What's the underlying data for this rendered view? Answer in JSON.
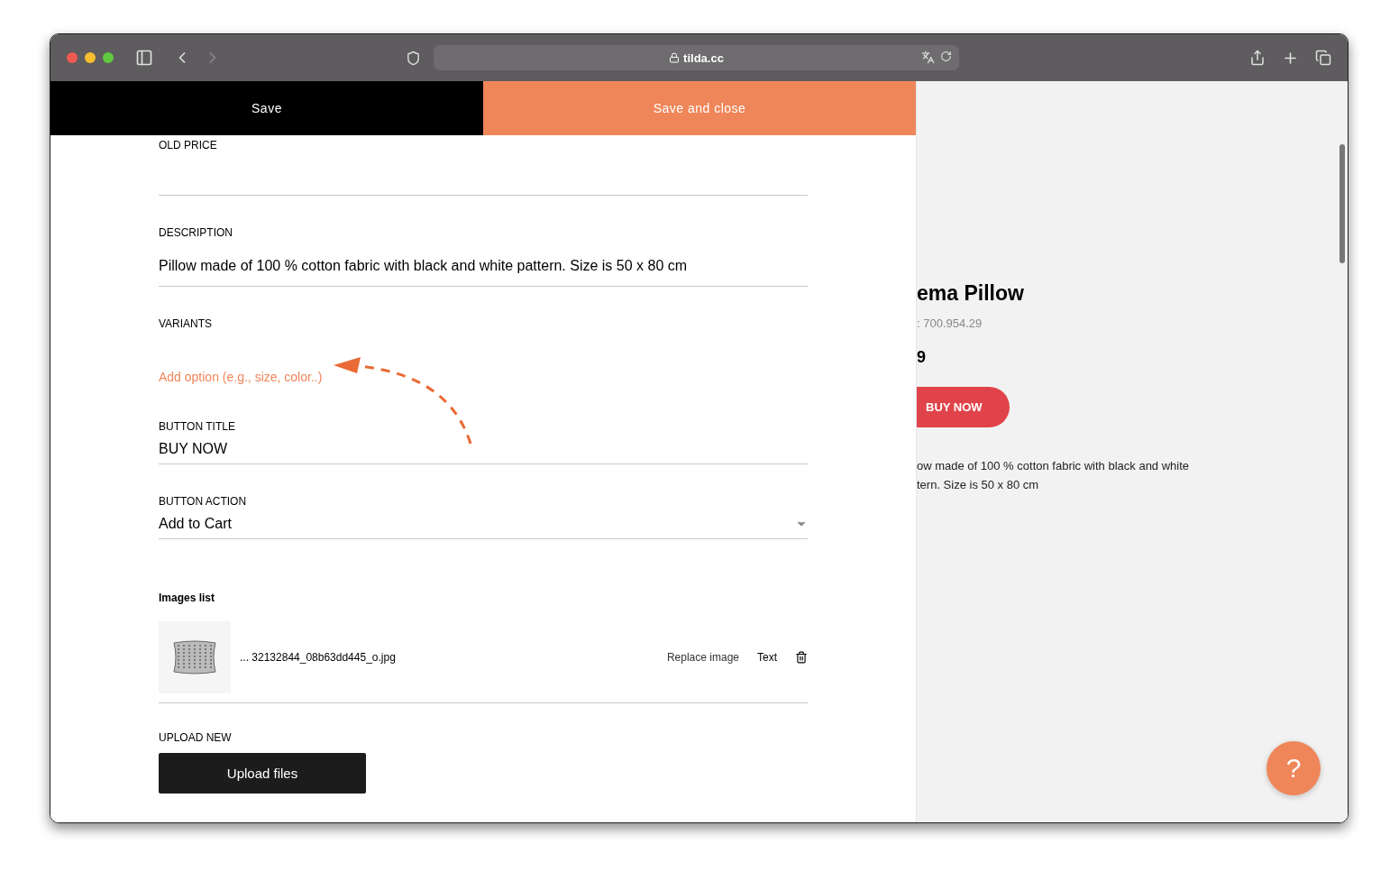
{
  "browser": {
    "url": "tilda.cc"
  },
  "editor": {
    "actions": [
      {
        "label": "Save",
        "kind": "dark"
      },
      {
        "label": "Save and close",
        "kind": "accent"
      }
    ],
    "fields": [
      {
        "kind": "text",
        "label": "OLD PRICE"
      },
      {
        "kind": "text",
        "label": "DESCRIPTION",
        "value": "Pillow made of 100 % cotton fabric with black and white pattern. Size is 50 x 80 cm"
      },
      {
        "kind": "link",
        "label": "VARIANTS",
        "value": "Add option (e.g., size, color..)"
      },
      {
        "kind": "text",
        "label": "BUTTON TITLE",
        "value": "BUY NOW"
      },
      {
        "kind": "dropdown",
        "label": "BUTTON ACTION",
        "value": "Add to Cart"
      }
    ],
    "images": {
      "heading": "Images list",
      "items": [
        {
          "filename": "... 32132844_08b63dd445_o.jpg",
          "actions": [
            "Replace image",
            "Text"
          ]
        }
      ]
    },
    "upload": {
      "label": "UPLOAD NEW",
      "button": "Upload files"
    }
  },
  "preview": {
    "title": "ema Pillow",
    "sku": ": 700.954.29",
    "price": "9",
    "button": "BUY NOW",
    "description": [
      "ow made of 100 % cotton fabric with black and white",
      "tern. Size is 50 x 80 cm"
    ]
  },
  "help": "?"
}
